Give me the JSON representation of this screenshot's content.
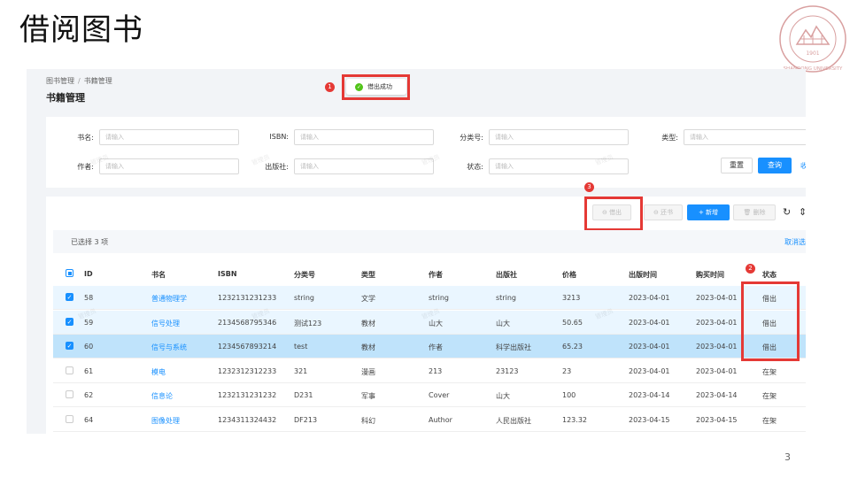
{
  "slide": {
    "title": "借阅图书",
    "page_number": "3",
    "logo_year": "1901",
    "logo_text": "SHANDONG UNIVERSITY"
  },
  "breadcrumb": {
    "items": [
      "图书管理",
      "书籍管理"
    ],
    "separator": "/"
  },
  "page_title": "书籍管理",
  "toast": {
    "text": "借出成功",
    "status_color": "#52c41a"
  },
  "annotations": [
    "1",
    "2",
    "3"
  ],
  "annotation_color": "#e53935",
  "search": {
    "fields": [
      {
        "label": "书名:",
        "placeholder": "请输入"
      },
      {
        "label": "ISBN:",
        "placeholder": "请输入"
      },
      {
        "label": "分类号:",
        "placeholder": "请输入"
      },
      {
        "label": "类型:",
        "placeholder": "请输入"
      },
      {
        "label": "作者:",
        "placeholder": "请输入"
      },
      {
        "label": "出版社:",
        "placeholder": "请输入"
      },
      {
        "label": "状态:",
        "placeholder": "请输入"
      }
    ],
    "reset_label": "重置",
    "query_label": "查询",
    "collapse_label": "收"
  },
  "toolbar": {
    "borrow_label": "借出",
    "return_label": "还书",
    "add_label": "+ 新增",
    "delete_label": "删除",
    "refresh_icon": "refresh-icon",
    "density_icon": "column-height-icon"
  },
  "selection": {
    "text": "已选择 3 项",
    "cancel_label": "取消选"
  },
  "watermark": "管理员",
  "primary_color": "#1890ff",
  "table": {
    "headers": [
      "ID",
      "书名",
      "ISBN",
      "分类号",
      "类型",
      "作者",
      "出版社",
      "价格",
      "出版时间",
      "购买时间",
      "状态"
    ],
    "rows": [
      [
        "58",
        "普通物理学",
        "1232131231233",
        "string",
        "文学",
        "string",
        "string",
        "3213",
        "2023-04-01",
        "2023-04-01",
        "借出"
      ],
      [
        "59",
        "信号处理",
        "2134568795346",
        "测试123",
        "教材",
        "山大",
        "山大",
        "50.65",
        "2023-04-01",
        "2023-04-01",
        "借出"
      ],
      [
        "60",
        "信号与系统",
        "1234567893214",
        "test",
        "教材",
        "作者",
        "科学出版社",
        "65.23",
        "2023-04-01",
        "2023-04-01",
        "借出"
      ],
      [
        "61",
        "模电",
        "1232312312233",
        "321",
        "漫画",
        "213",
        "23123",
        "23",
        "2023-04-01",
        "2023-04-01",
        "在架"
      ],
      [
        "62",
        "信息论",
        "1232131231232",
        "D231",
        "军事",
        "Cover",
        "山大",
        "100",
        "2023-04-14",
        "2023-04-14",
        "在架"
      ],
      [
        "64",
        "图像处理",
        "1234311324432",
        "DF213",
        "科幻",
        "Author",
        "人民出版社",
        "123.32",
        "2023-04-15",
        "2023-04-15",
        "在架"
      ]
    ],
    "selected": [
      true,
      true,
      true,
      false,
      false,
      false
    ]
  }
}
